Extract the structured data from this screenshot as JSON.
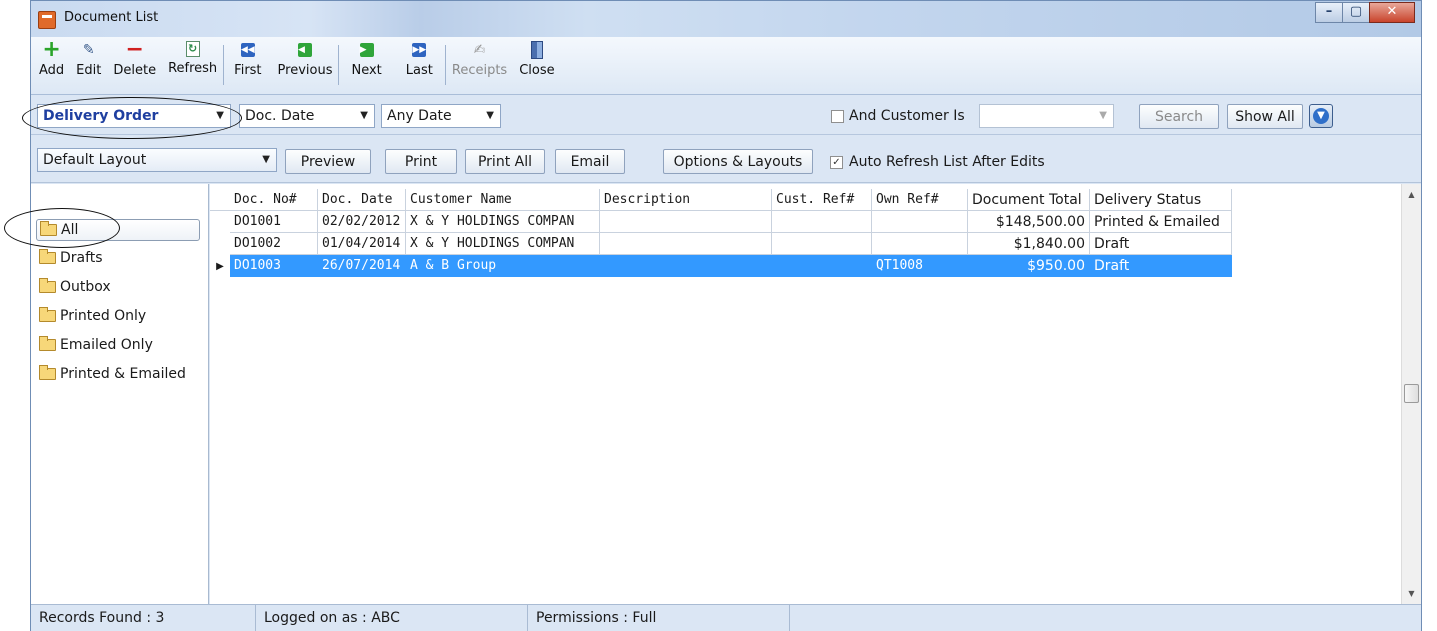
{
  "window": {
    "title": "Document List",
    "controls": [
      "minimize",
      "maximize",
      "close"
    ]
  },
  "toolbar": {
    "buttons": [
      {
        "label": "Add",
        "icon": "add-icon"
      },
      {
        "label": "Edit",
        "icon": "edit-icon"
      },
      {
        "label": "Delete",
        "icon": "delete-icon"
      },
      {
        "label": "Refresh",
        "icon": "refresh-icon"
      },
      {
        "label": "First",
        "icon": "first-icon"
      },
      {
        "label": "Previous",
        "icon": "previous-icon"
      },
      {
        "label": "Next",
        "icon": "next-icon"
      },
      {
        "label": "Last",
        "icon": "last-icon"
      },
      {
        "label": "Receipts",
        "icon": "receipts-icon",
        "disabled": true
      },
      {
        "label": "Close",
        "icon": "close-door-icon"
      }
    ]
  },
  "filters": {
    "document_type": "Delivery Order",
    "date_field": "Doc. Date",
    "date_range": "Any Date",
    "customer_checkbox_label": "And Customer Is",
    "customer_checked": false,
    "customer_value": "",
    "search_label": "Search",
    "show_all_label": "Show All"
  },
  "layout": {
    "selected_layout": "Default Layout",
    "preview_label": "Preview",
    "print_label": "Print",
    "print_all_label": "Print All",
    "email_label": "Email",
    "options_label": "Options & Layouts",
    "auto_refresh_label": "Auto Refresh List After Edits",
    "auto_refresh_checked": true
  },
  "sidebar": {
    "folders": [
      {
        "label": "All",
        "selected": true
      },
      {
        "label": "Drafts"
      },
      {
        "label": "Outbox"
      },
      {
        "label": "Printed Only"
      },
      {
        "label": "Emailed Only"
      },
      {
        "label": "Printed & Emailed"
      }
    ]
  },
  "grid": {
    "columns": [
      "Doc. No#",
      "Doc. Date",
      "Customer Name",
      "Description",
      "Cust. Ref#",
      "Own Ref#",
      "Document Total",
      "Delivery Status"
    ],
    "rows": [
      [
        "DO1001",
        "02/02/2012",
        "X & Y HOLDINGS COMPAN",
        "",
        "",
        "",
        "$148,500.00",
        "Printed & Emailed"
      ],
      [
        "DO1002",
        "01/04/2014",
        "X & Y HOLDINGS COMPAN",
        "",
        "",
        "",
        "$1,840.00",
        "Draft"
      ],
      [
        "DO1003",
        "26/07/2014",
        "A & B Group",
        "",
        "",
        "QT1008",
        "$950.00",
        "Draft"
      ]
    ],
    "selected_row": 2
  },
  "status": {
    "records": "Records Found : 3",
    "logged_on": "Logged on as : ABC",
    "permissions": "Permissions : Full"
  }
}
